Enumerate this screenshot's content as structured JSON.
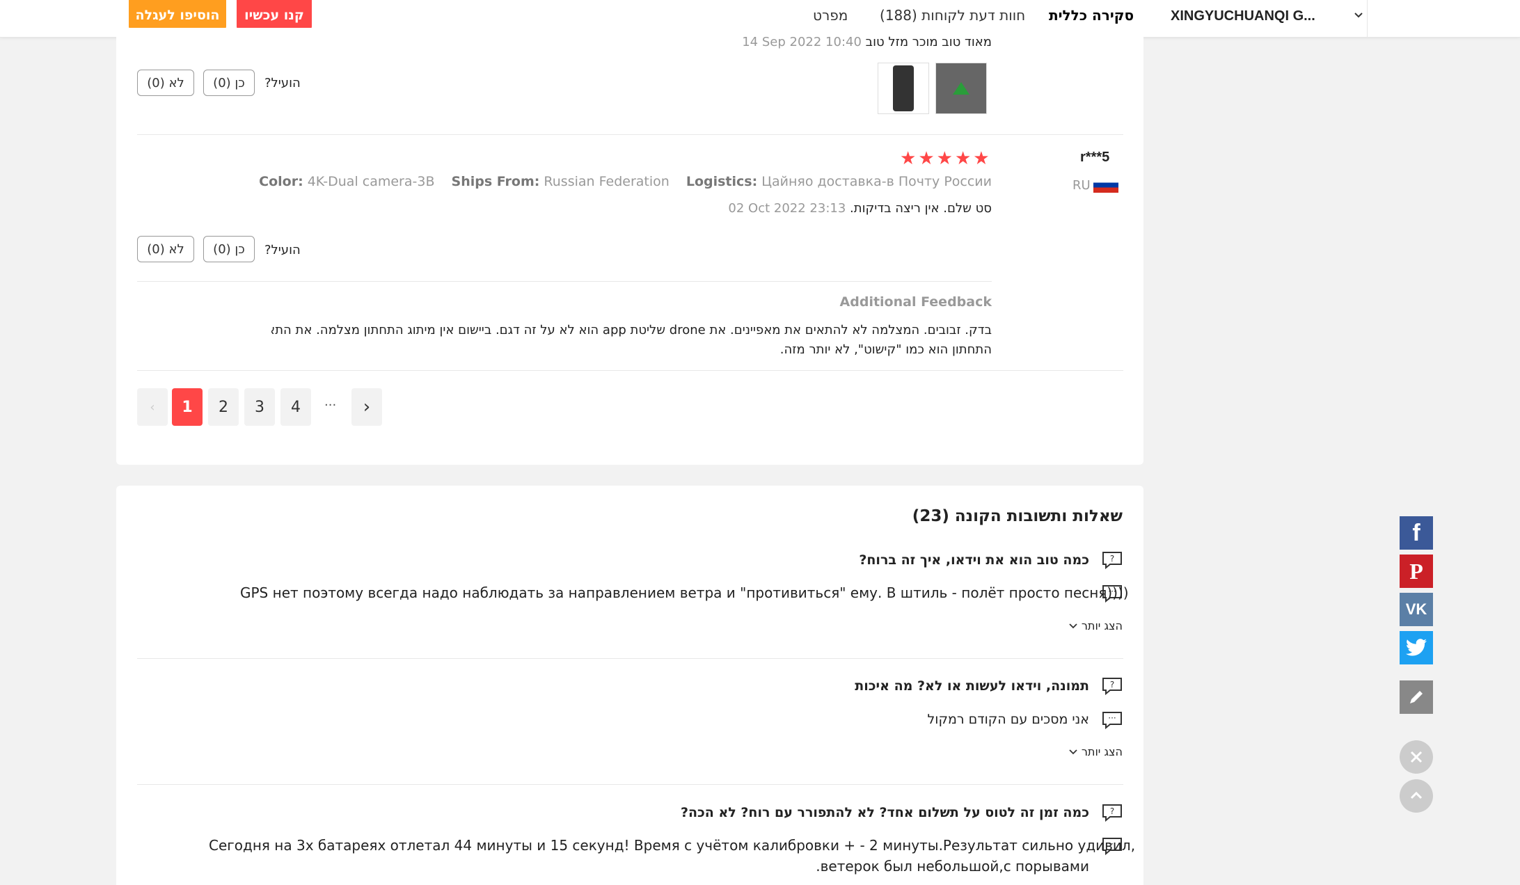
{
  "header": {
    "add_to_cart": "הוסיפו לעגלה",
    "buy_now": "קנו עכשיו",
    "tabs": [
      "מפרט",
      "חוות דעת לקוחות (188)",
      "סקירה כללית"
    ],
    "store_name": "XINGYUCHUANQI G..."
  },
  "reviews": {
    "prev_text": "מאוד טוב מוכר מזל טוב",
    "prev_date": "14 Sep 2022 10:40",
    "helpful_label": "הועיל?",
    "yes_label": "כן (0)",
    "no_label": "לא (0)",
    "review": {
      "user": "r***5",
      "country": "RU",
      "stars": 5,
      "attrs": [
        {
          "k": "Logistics:",
          "v": "Цайняо доставка-в Почту России"
        },
        {
          "k": "Ships From:",
          "v": "Russian Federation"
        },
        {
          "k": "Color:",
          "v": "4K-Dual camera-3B"
        }
      ],
      "text": "סט שלם. אין ריצה בדיקות.",
      "date": "02 Oct 2022 23:13"
    },
    "additional_title": "Additional Feedback",
    "additional_line1": "בדק. זבובים. המצלמה לא להתאים את מאפיינים. את drone שליטת app הוא לא על זה דגם. ביישום אין מיתוג התחתון מצלמה. את התא",
    "additional_line2": "התחתון הוא כמו \"קישוט\", לא יותר מזה."
  },
  "pagination": {
    "pages": [
      "1",
      "2",
      "3",
      "4"
    ],
    "ellipsis": "···",
    "current": "1"
  },
  "qa": {
    "title": "שאלות ותשובות הקונה (23)",
    "more_label": "הצג יותר",
    "items": [
      {
        "q": "כמה טוב הוא את וידאו, איך זה ברוח?",
        "a": "GPS нет поэтому всегда надо наблюдать за направлением ветра и \"противиться\" ему. В штиль - полёт просто песня))))"
      },
      {
        "q": "תמונה, וידאו לעשות או לא? מה איכות",
        "a": "אני מסכים עם הקודם רמקול"
      },
      {
        "q": "כמה זמן זה לטוס על תשלום אחד? לא להתפורר עם רוח? לא הכה?",
        "a1": "Сегодня на 3х батареях отлетал 44 минуты и 15 секунд! Время с учётом калибровки + - 2 минуты.Результат сильно удивил,",
        "a2": "ветерок был небольшой,с порывами."
      }
    ]
  },
  "colors": {
    "accent": "#ff4747",
    "orange": "#ff9e1f",
    "facebook": "#3b5998",
    "pinterest": "#cb2027",
    "vk": "#5b7fa6",
    "twitter": "#1da1f2"
  },
  "social_icons": [
    "facebook-icon",
    "pinterest-icon",
    "vk-icon",
    "twitter-icon",
    "pencil-icon",
    "close-icon",
    "scroll-top-icon"
  ]
}
